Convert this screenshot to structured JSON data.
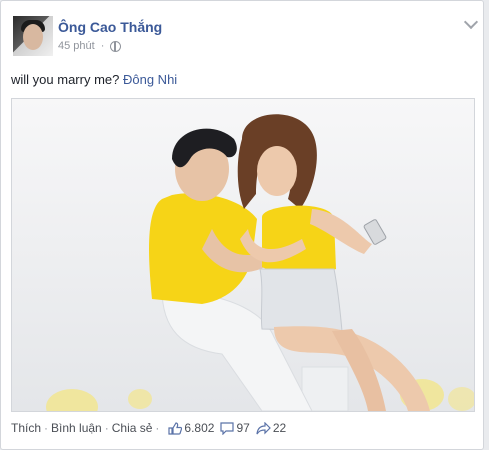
{
  "post": {
    "author": "Ông Cao Thắng",
    "time": "45 phút",
    "status_text": "will you marry me?",
    "tagged": "Đông Nhi",
    "privacy_icon": "globe-icon",
    "menu_icon": "chevron-down-icon"
  },
  "actions": {
    "like": "Thích",
    "comment": "Bình luận",
    "share": "Chia sẻ",
    "separator": "·"
  },
  "counts": {
    "likes": "6.802",
    "comments": "97",
    "shares": "22"
  },
  "colors": {
    "link": "#3b5998",
    "text": "#1d2129",
    "muted": "#90949c",
    "shirt_yellow": "#f6d417"
  }
}
